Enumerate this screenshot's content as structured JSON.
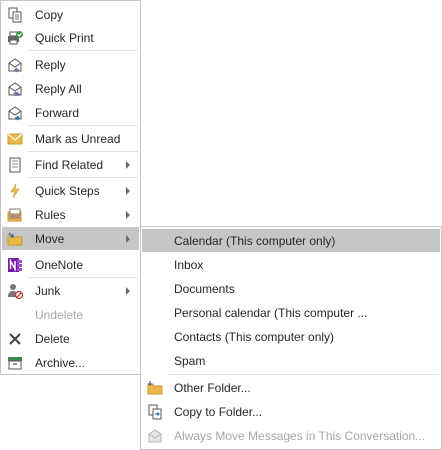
{
  "main_menu": {
    "items": [
      {
        "label": "Copy",
        "icon": "copy-icon"
      },
      {
        "label": "Quick Print",
        "icon": "quick-print-icon"
      },
      {
        "label": "Reply",
        "icon": "reply-icon"
      },
      {
        "label": "Reply All",
        "icon": "reply-all-icon"
      },
      {
        "label": "Forward",
        "icon": "forward-icon"
      },
      {
        "label": "Mark as Unread",
        "icon": "mark-unread-icon"
      },
      {
        "label": "Find Related",
        "icon": "find-related-icon",
        "submenu": true
      },
      {
        "label": "Quick Steps",
        "icon": "quick-steps-icon",
        "submenu": true
      },
      {
        "label": "Rules",
        "icon": "rules-icon",
        "submenu": true
      },
      {
        "label": "Move",
        "icon": "move-icon",
        "submenu": true,
        "highlighted": true
      },
      {
        "label": "OneNote",
        "icon": "onenote-icon"
      },
      {
        "label": "Junk",
        "icon": "junk-icon",
        "submenu": true
      },
      {
        "label": "Undelete",
        "icon": "undelete-icon",
        "disabled": true
      },
      {
        "label": "Delete",
        "icon": "delete-icon"
      },
      {
        "label": "Archive...",
        "icon": "archive-icon"
      }
    ]
  },
  "move_submenu": {
    "items": [
      {
        "label": "Calendar (This computer only)",
        "highlighted": true
      },
      {
        "label": "Inbox"
      },
      {
        "label": "Documents"
      },
      {
        "label": "Personal calendar (This computer ..."
      },
      {
        "label": "Contacts (This computer only)"
      },
      {
        "label": "Spam"
      },
      {
        "label": "Other Folder...",
        "icon": "other-folder-icon"
      },
      {
        "label": "Copy to Folder...",
        "icon": "copy-to-folder-icon"
      },
      {
        "label": "Always Move Messages in This Conversation...",
        "icon": "always-move-icon",
        "disabled": true
      }
    ]
  },
  "colors": {
    "highlight": "#c6c6c6",
    "border": "#c6c6c6",
    "text": "#262626",
    "disabled_text": "#a6a6a6",
    "onenote_purple": "#7719aa",
    "folder_yellow": "#e8b84a",
    "reply_purple": "#8064a2",
    "forward_blue": "#2f6fb5"
  }
}
